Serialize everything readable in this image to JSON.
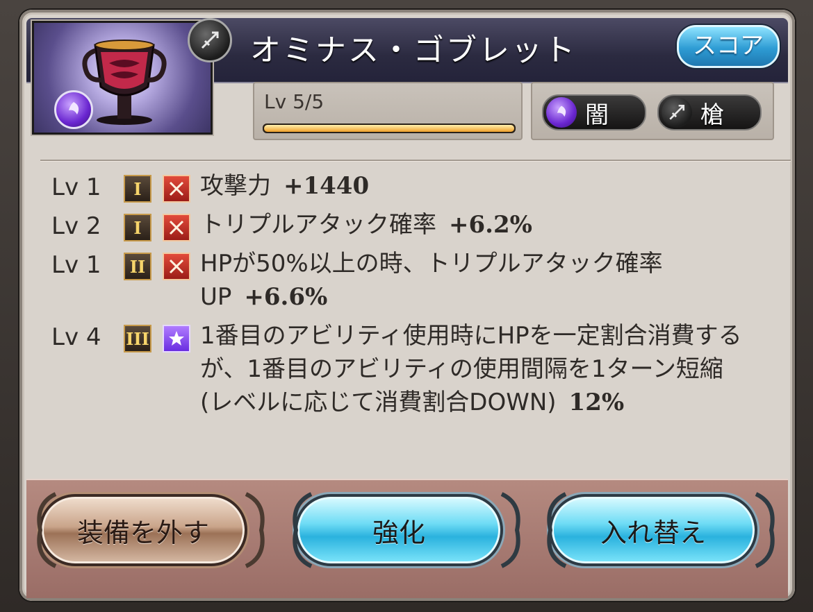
{
  "item": {
    "name": "オミナス・ゴブレット",
    "score_label": "スコア",
    "level_text": "Lv 5/5",
    "level_progress": 1.0,
    "element_label": "闇",
    "weapon_type_label": "槍"
  },
  "skills": [
    {
      "level": "Lv 1",
      "rank": "I",
      "icon": "attack-icon",
      "text": "攻撃力",
      "value": "+1440"
    },
    {
      "level": "Lv 2",
      "rank": "I",
      "icon": "attack-icon",
      "text": "トリプルアタック確率",
      "value": "+6.2%"
    },
    {
      "level": "Lv 1",
      "rank": "II",
      "icon": "attack-icon",
      "text": "HPが50%以上の時、トリプルアタック確率UP",
      "value": "+6.6%"
    },
    {
      "level": "Lv 4",
      "rank": "III",
      "icon": "star-icon",
      "text": "1番目のアビリティ使用時にHPを一定割合消費するが、1番目のアビリティの使用間隔を1ターン短縮(レベルに応じて消費割合DOWN)",
      "value": "12%"
    }
  ],
  "buttons": {
    "unequip": "装備を外す",
    "enhance": "強化",
    "swap": "入れ替え"
  },
  "colors": {
    "panel_bg": "#d9d3cc",
    "header_bg": "#2b2a40",
    "score_button": "#2e9cd4",
    "enhance_button": "#2ab2de",
    "unequip_button": "#9c7257",
    "level_bar": "#f0a02a",
    "dark_element": "#6a26d0"
  }
}
